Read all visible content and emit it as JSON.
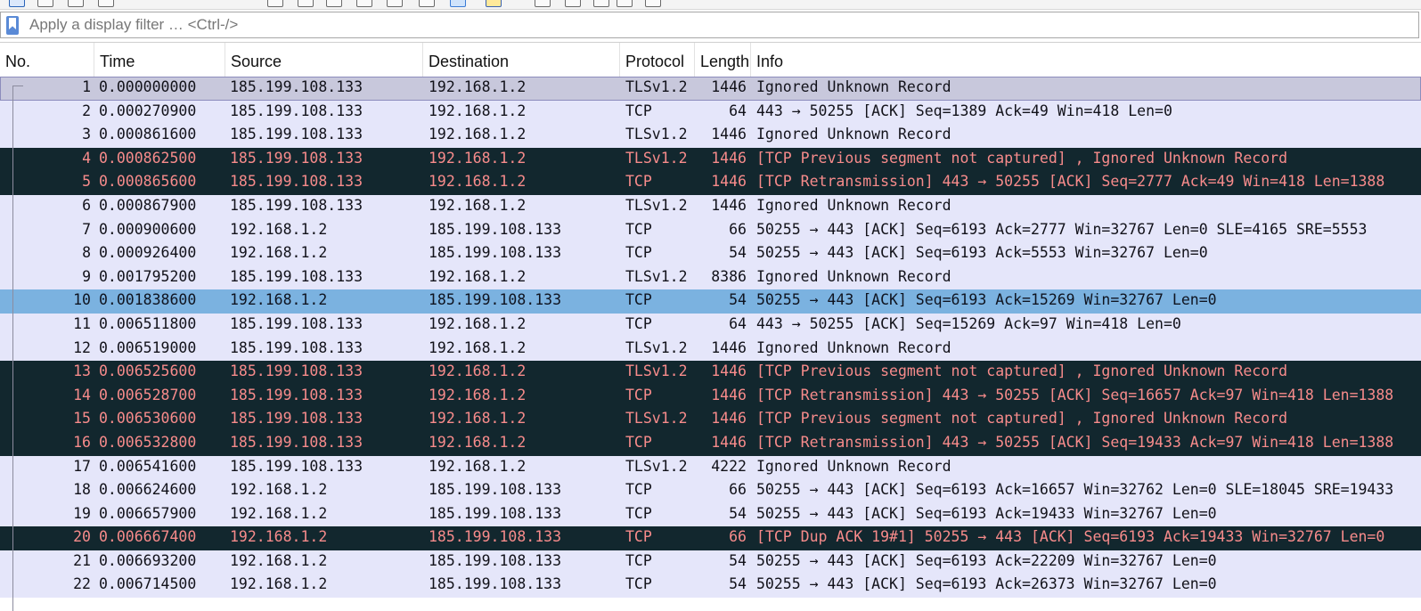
{
  "filter": {
    "placeholder": "Apply a display filter … <Ctrl-/>",
    "icon": "bookmark-icon"
  },
  "columns": [
    "No.",
    "Time",
    "Source",
    "Destination",
    "Protocol",
    "Length",
    "Info"
  ],
  "colors": {
    "normal_bg": "#e5e6fa",
    "bad_bg": "#12272e",
    "bad_fg": "#f78b8b",
    "selected_bg": "#7bb2e0"
  },
  "packets": [
    {
      "no": "1",
      "time": "0.000000000",
      "src": "185.199.108.133",
      "dst": "192.168.1.2",
      "proto": "TLSv1.2",
      "len": "1446",
      "info": "Ignored Unknown Record",
      "style": "first"
    },
    {
      "no": "2",
      "time": "0.000270900",
      "src": "185.199.108.133",
      "dst": "192.168.1.2",
      "proto": "TCP",
      "len": "64",
      "info": "443 → 50255 [ACK] Seq=1389 Ack=49 Win=418 Len=0",
      "style": "normal"
    },
    {
      "no": "3",
      "time": "0.000861600",
      "src": "185.199.108.133",
      "dst": "192.168.1.2",
      "proto": "TLSv1.2",
      "len": "1446",
      "info": "Ignored Unknown Record",
      "style": "normal"
    },
    {
      "no": "4",
      "time": "0.000862500",
      "src": "185.199.108.133",
      "dst": "192.168.1.2",
      "proto": "TLSv1.2",
      "len": "1446",
      "info": "[TCP Previous segment not captured] , Ignored Unknown Record",
      "style": "bad"
    },
    {
      "no": "5",
      "time": "0.000865600",
      "src": "185.199.108.133",
      "dst": "192.168.1.2",
      "proto": "TCP",
      "len": "1446",
      "info": "[TCP Retransmission] 443 → 50255 [ACK] Seq=2777 Ack=49 Win=418 Len=1388",
      "style": "bad"
    },
    {
      "no": "6",
      "time": "0.000867900",
      "src": "185.199.108.133",
      "dst": "192.168.1.2",
      "proto": "TLSv1.2",
      "len": "1446",
      "info": "Ignored Unknown Record",
      "style": "normal"
    },
    {
      "no": "7",
      "time": "0.000900600",
      "src": "192.168.1.2",
      "dst": "185.199.108.133",
      "proto": "TCP",
      "len": "66",
      "info": "50255 → 443 [ACK] Seq=6193 Ack=2777 Win=32767 Len=0 SLE=4165 SRE=5553",
      "style": "normal"
    },
    {
      "no": "8",
      "time": "0.000926400",
      "src": "192.168.1.2",
      "dst": "185.199.108.133",
      "proto": "TCP",
      "len": "54",
      "info": "50255 → 443 [ACK] Seq=6193 Ack=5553 Win=32767 Len=0",
      "style": "normal"
    },
    {
      "no": "9",
      "time": "0.001795200",
      "src": "185.199.108.133",
      "dst": "192.168.1.2",
      "proto": "TLSv1.2",
      "len": "8386",
      "info": "Ignored Unknown Record",
      "style": "normal"
    },
    {
      "no": "10",
      "time": "0.001838600",
      "src": "192.168.1.2",
      "dst": "185.199.108.133",
      "proto": "TCP",
      "len": "54",
      "info": "50255 → 443 [ACK] Seq=6193 Ack=15269 Win=32767 Len=0",
      "style": "selected"
    },
    {
      "no": "11",
      "time": "0.006511800",
      "src": "185.199.108.133",
      "dst": "192.168.1.2",
      "proto": "TCP",
      "len": "64",
      "info": "443 → 50255 [ACK] Seq=15269 Ack=97 Win=418 Len=0",
      "style": "normal"
    },
    {
      "no": "12",
      "time": "0.006519000",
      "src": "185.199.108.133",
      "dst": "192.168.1.2",
      "proto": "TLSv1.2",
      "len": "1446",
      "info": "Ignored Unknown Record",
      "style": "normal"
    },
    {
      "no": "13",
      "time": "0.006525600",
      "src": "185.199.108.133",
      "dst": "192.168.1.2",
      "proto": "TLSv1.2",
      "len": "1446",
      "info": "[TCP Previous segment not captured] , Ignored Unknown Record",
      "style": "bad"
    },
    {
      "no": "14",
      "time": "0.006528700",
      "src": "185.199.108.133",
      "dst": "192.168.1.2",
      "proto": "TCP",
      "len": "1446",
      "info": "[TCP Retransmission] 443 → 50255 [ACK] Seq=16657 Ack=97 Win=418 Len=1388",
      "style": "bad"
    },
    {
      "no": "15",
      "time": "0.006530600",
      "src": "185.199.108.133",
      "dst": "192.168.1.2",
      "proto": "TLSv1.2",
      "len": "1446",
      "info": "[TCP Previous segment not captured] , Ignored Unknown Record",
      "style": "bad"
    },
    {
      "no": "16",
      "time": "0.006532800",
      "src": "185.199.108.133",
      "dst": "192.168.1.2",
      "proto": "TCP",
      "len": "1446",
      "info": "[TCP Retransmission] 443 → 50255 [ACK] Seq=19433 Ack=97 Win=418 Len=1388",
      "style": "bad"
    },
    {
      "no": "17",
      "time": "0.006541600",
      "src": "185.199.108.133",
      "dst": "192.168.1.2",
      "proto": "TLSv1.2",
      "len": "4222",
      "info": "Ignored Unknown Record",
      "style": "normal"
    },
    {
      "no": "18",
      "time": "0.006624600",
      "src": "192.168.1.2",
      "dst": "185.199.108.133",
      "proto": "TCP",
      "len": "66",
      "info": "50255 → 443 [ACK] Seq=6193 Ack=16657 Win=32762 Len=0 SLE=18045 SRE=19433",
      "style": "normal"
    },
    {
      "no": "19",
      "time": "0.006657900",
      "src": "192.168.1.2",
      "dst": "185.199.108.133",
      "proto": "TCP",
      "len": "54",
      "info": "50255 → 443 [ACK] Seq=6193 Ack=19433 Win=32767 Len=0",
      "style": "normal"
    },
    {
      "no": "20",
      "time": "0.006667400",
      "src": "192.168.1.2",
      "dst": "185.199.108.133",
      "proto": "TCP",
      "len": "66",
      "info": "[TCP Dup ACK 19#1] 50255 → 443 [ACK] Seq=6193 Ack=19433 Win=32767 Len=0",
      "style": "bad"
    },
    {
      "no": "21",
      "time": "0.006693200",
      "src": "192.168.1.2",
      "dst": "185.199.108.133",
      "proto": "TCP",
      "len": "54",
      "info": "50255 → 443 [ACK] Seq=6193 Ack=22209 Win=32767 Len=0",
      "style": "normal"
    },
    {
      "no": "22",
      "time": "0.006714500",
      "src": "192.168.1.2",
      "dst": "185.199.108.133",
      "proto": "TCP",
      "len": "54",
      "info": "50255 → 443 [ACK] Seq=6193 Ack=26373 Win=32767 Len=0",
      "style": "normal"
    }
  ]
}
